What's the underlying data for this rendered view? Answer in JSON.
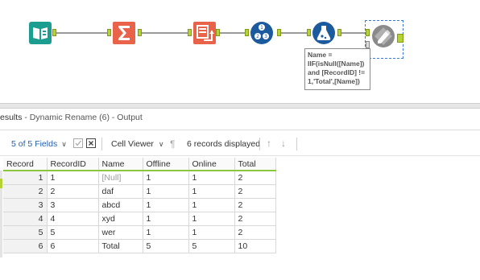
{
  "canvas": {
    "annotation": "Name = IIF(isNull([Name]) and [RecordID] != 1,'Total',[Name])",
    "tools": [
      {
        "name": "input-data-icon",
        "color": "#1b9e8f"
      },
      {
        "name": "summarize-icon",
        "color": "#e8634a"
      },
      {
        "name": "union-icon",
        "color": "#e8634a"
      },
      {
        "name": "record-id-icon",
        "color": "#1c5a9e"
      },
      {
        "name": "formula-icon",
        "color": "#1c5a9e"
      },
      {
        "name": "dynamic-rename-icon",
        "color": "#8a8a8a"
      }
    ]
  },
  "results": {
    "title_prefix": "esults",
    "title_suffix": " - Dynamic Rename (6) - Output",
    "fields_label": "5 of 5 Fields",
    "cell_viewer_label": "Cell Viewer",
    "records_displayed": "6 records displayed"
  },
  "table": {
    "columns": [
      "Record",
      "RecordID",
      "Name",
      "Offline",
      "Online",
      "Total"
    ],
    "rows": [
      [
        "1",
        "1",
        "[Null]",
        "1",
        "1",
        "2"
      ],
      [
        "2",
        "2",
        "daf",
        "1",
        "1",
        "2"
      ],
      [
        "3",
        "3",
        "abcd",
        "1",
        "1",
        "2"
      ],
      [
        "4",
        "4",
        "xyd",
        "1",
        "1",
        "2"
      ],
      [
        "5",
        "5",
        "wer",
        "1",
        "1",
        "2"
      ],
      [
        "6",
        "6",
        "Total",
        "5",
        "5",
        "10"
      ]
    ]
  },
  "colors": {
    "accent": "#b5d334",
    "link": "#1f5fae",
    "selection": "#3a7bd5"
  }
}
